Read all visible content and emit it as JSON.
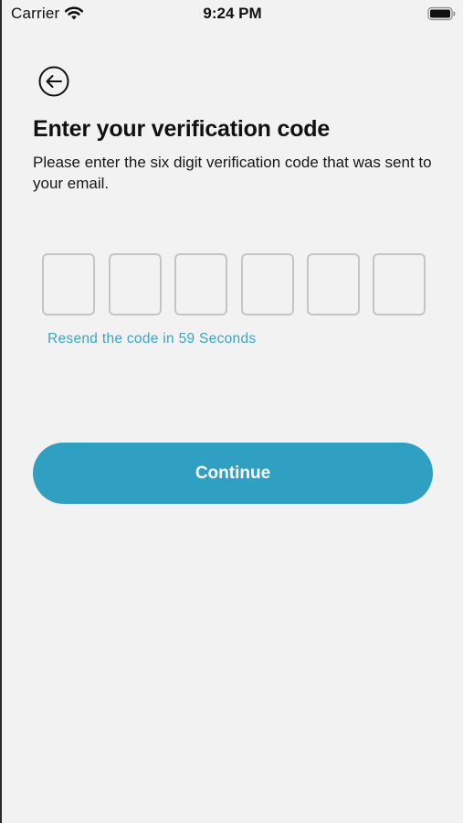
{
  "status_bar": {
    "carrier": "Carrier",
    "time": "9:24 PM",
    "wifi_icon": "wifi-icon",
    "battery_icon": "battery-icon"
  },
  "back_icon": "arrow-left-circle-icon",
  "title": "Enter your verification code",
  "subtitle": "Please enter the six digit verification code that was sent to your email.",
  "code_inputs": [
    "",
    "",
    "",
    "",
    "",
    ""
  ],
  "resend_text": "Resend the code in 59 Seconds",
  "continue_label": "Continue",
  "colors": {
    "accent": "#2f9fc2",
    "link": "#3aa5c4",
    "background": "#f2f2f2",
    "input_border": "#c5c5c5"
  }
}
